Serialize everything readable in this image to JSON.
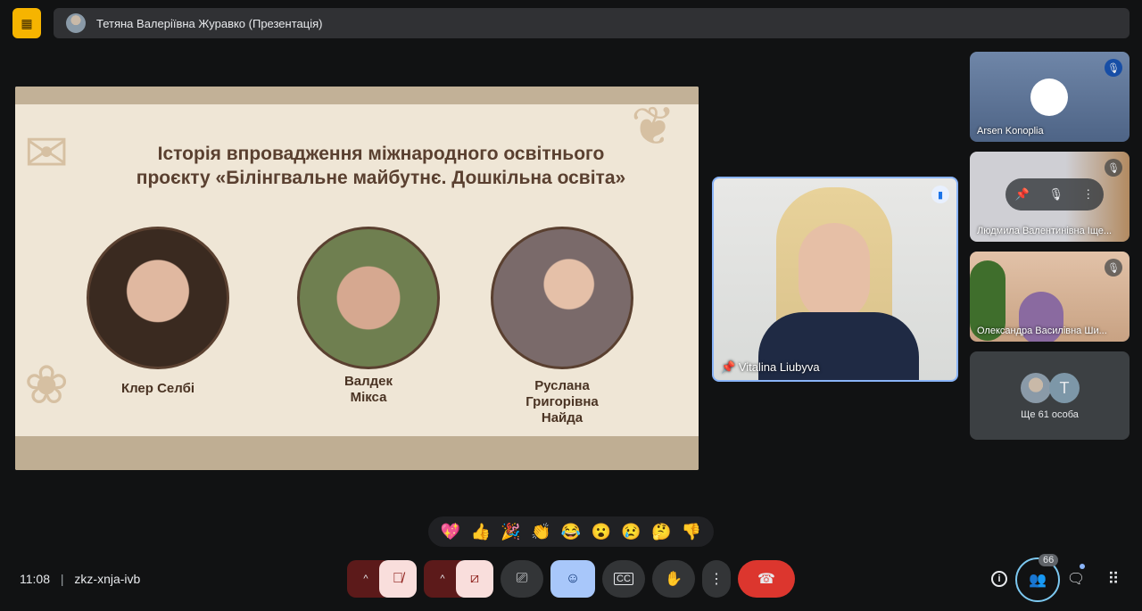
{
  "header": {
    "presenter_label": "Тетяна Валеріївна Журавко (Презентація)"
  },
  "slide": {
    "title": "Історія впровадження міжнародного освітнього проєкту «Білінгвальне майбутнє. Дошкільна освіта»",
    "people": [
      {
        "name": "Клер Селбі"
      },
      {
        "name": "Валдек Мікса"
      },
      {
        "name": "Руслана Григорівна Найда"
      }
    ]
  },
  "speaker": {
    "name": "Vitalina Liubyva"
  },
  "participants": [
    {
      "name": "Arsen Konoplia"
    },
    {
      "name": "Людмила Валентинівна Іще..."
    },
    {
      "name": "Олександра Василівна Ши..."
    }
  ],
  "more": {
    "label": "Ще 61 особа",
    "avatar_letter": "T"
  },
  "reactions": [
    "💖",
    "👍",
    "🎉",
    "👏",
    "😂",
    "😮",
    "😢",
    "🤔",
    "👎"
  ],
  "footer": {
    "time": "11:08",
    "separator": "|",
    "meeting_code": "zkz-xnja-ivb",
    "people_count": "66"
  },
  "colors": {
    "accent": "#8ab4f8",
    "end_call": "#ea4335",
    "present": "#f6b400"
  }
}
